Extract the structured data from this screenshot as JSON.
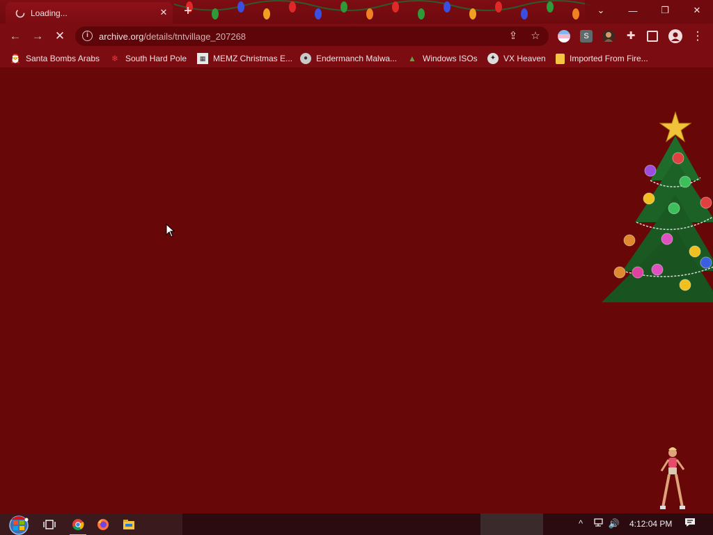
{
  "tab": {
    "title": "Loading...",
    "close_glyph": "✕",
    "new_tab_glyph": "+"
  },
  "window": {
    "dropdown_glyph": "⌄",
    "minimize_glyph": "—",
    "restore_glyph": "❐",
    "close_glyph": "✕"
  },
  "toolbar": {
    "back_glyph": "←",
    "forward_glyph": "→",
    "stop_glyph": "✕",
    "url_host": "archive.org",
    "url_rest": "/details/tntvillage_207268",
    "share_glyph": "⇪",
    "star_glyph": "☆",
    "menu_glyph": "⋮"
  },
  "extensions": [
    {
      "name": "flag-extension",
      "glyph": ""
    },
    {
      "name": "s-extension",
      "glyph": "S"
    },
    {
      "name": "avatar-extension",
      "glyph": ""
    }
  ],
  "bookmarks": [
    {
      "label": "Santa Bombs Arabs",
      "icon": "santa-icon"
    },
    {
      "label": "South Hard Pole",
      "icon": "snowflake-icon"
    },
    {
      "label": "MEMZ Christmas E...",
      "icon": "memz-icon"
    },
    {
      "label": "Endermanch Malwa...",
      "icon": "raccoon-icon"
    },
    {
      "label": "Windows ISOs",
      "icon": "tree-icon"
    },
    {
      "label": "VX Heaven",
      "icon": "vx-icon"
    },
    {
      "label": "Imported From Fire...",
      "icon": "folder-icon"
    }
  ],
  "taskbar": {
    "clock": "4:12:04 PM",
    "chevron_glyph": "^",
    "speaker_glyph": "🔊"
  },
  "colors": {
    "page_bg": "#680707",
    "chrome": "#7a0c12",
    "accent": "#9ec3ff"
  }
}
